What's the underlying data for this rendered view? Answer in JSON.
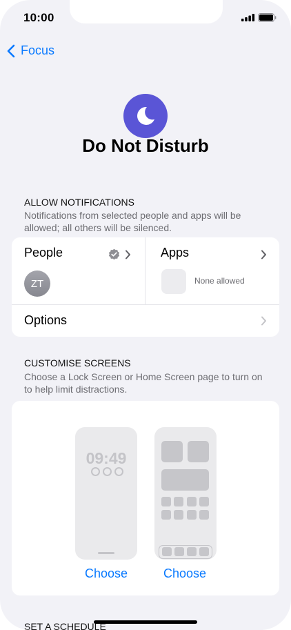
{
  "status_bar": {
    "time": "10:00"
  },
  "nav": {
    "back_label": "Focus"
  },
  "focus": {
    "title": "Do Not Disturb",
    "icon": "moon-icon",
    "accent": "#5a55d6"
  },
  "allow_notifications": {
    "header": "ALLOW NOTIFICATIONS",
    "description": "Notifications from selected people and apps will be allowed; all others will be silenced.",
    "people_label": "People",
    "people_avatar_initials": "ZT",
    "apps_label": "Apps",
    "apps_status": "None allowed",
    "options_label": "Options"
  },
  "customise_screens": {
    "header": "CUSTOMISE SCREENS",
    "description": "Choose a Lock Screen or Home Screen page to turn on to help limit distractions.",
    "lock_preview_time": "09:49",
    "lock_choose_label": "Choose",
    "home_choose_label": "Choose"
  },
  "schedule": {
    "header": "SET A SCHEDULE"
  },
  "colors": {
    "link": "#0a7aff",
    "background": "#f2f2f7"
  }
}
